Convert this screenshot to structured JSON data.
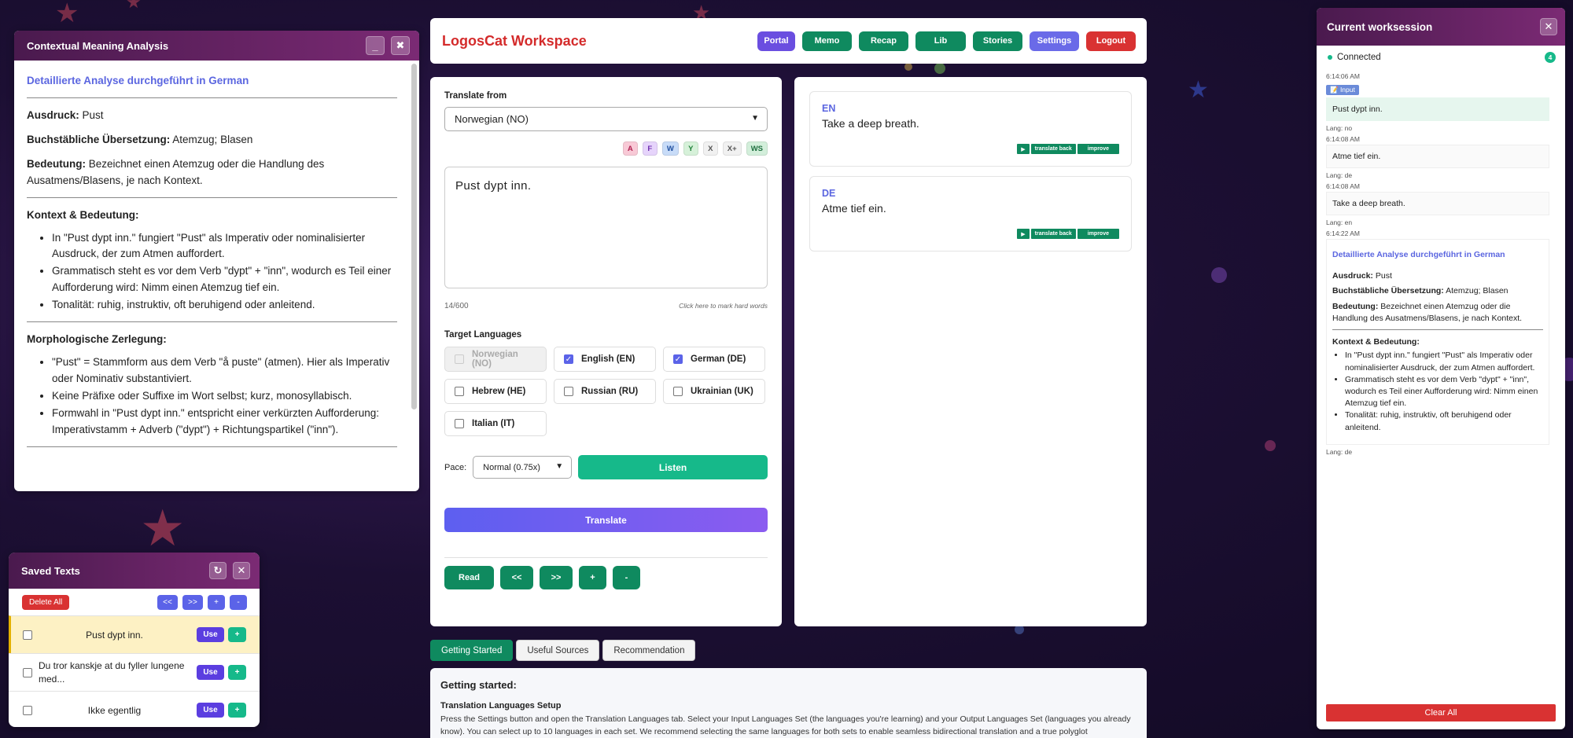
{
  "header": {
    "brand": "LogosCat Workspace",
    "nav": [
      {
        "label": "Portal",
        "color": "#6a4ee0"
      },
      {
        "label": "Memo",
        "color": "#0f8a5f"
      },
      {
        "label": "Recap",
        "color": "#0f8a5f"
      },
      {
        "label": "Lib",
        "color": "#0f8a5f"
      },
      {
        "label": "Stories",
        "color": "#0f8a5f"
      },
      {
        "label": "Settings",
        "color": "#6a6ae8"
      },
      {
        "label": "Logout",
        "color": "#d93232"
      }
    ]
  },
  "analysis": {
    "title": "Contextual Meaning Analysis",
    "minimize": "_",
    "close": "✖",
    "heading": "Detaillierte Analyse durchgeführt in German",
    "ausdruck_label": "Ausdruck:",
    "ausdruck": " Pust",
    "literal_label": "Buchstäbliche Übersetzung:",
    "literal": " Atemzug; Blasen",
    "meaning_label": "Bedeutung:",
    "meaning": " Bezeichnet einen Atemzug oder die Handlung des Ausatmens/Blasens, je nach Kontext.",
    "context_title": "Kontext & Bedeutung:",
    "context_items": [
      "In \"Pust dypt inn.\" fungiert \"Pust\" als Imperativ oder nominalisierter Ausdruck, der zum Atmen auffordert.",
      "Grammatisch steht es vor dem Verb \"dypt\" + \"inn\", wodurch es Teil einer Aufforderung wird: Nimm einen Atemzug tief ein.",
      "Tonalität: ruhig, instruktiv, oft beruhigend oder anleitend."
    ],
    "morph_title": "Morphologische Zerlegung:",
    "morph_items": [
      "\"Pust\" = Stammform aus dem Verb \"å puste\" (atmen). Hier als Imperativ oder Nominativ substantiviert.",
      "Keine Präfixe oder Suffixe im Wort selbst; kurz, monosyllabisch.",
      "Formwahl in \"Pust dypt inn.\" entspricht einer verkürzten Aufforderung: Imperativstamm + Adverb (\"dypt\") + Richtungspartikel (\"inn\")."
    ]
  },
  "saved": {
    "title": "Saved Texts",
    "refresh": "↻",
    "close": "✕",
    "delete_all": "Delete All",
    "nav_buttons": [
      "<<",
      ">>",
      "+",
      "-"
    ],
    "use_label": "Use",
    "add_label": "+",
    "items": [
      {
        "text": "Pust dypt inn."
      },
      {
        "text": "Du tror kanskje at du fyller lungene med..."
      },
      {
        "text": "Ikke egentlig"
      }
    ]
  },
  "translate": {
    "from_label": "Translate from",
    "from_value": "Norwegian (NO)",
    "chips": [
      {
        "label": "A",
        "bg": "#f8c9d6"
      },
      {
        "label": "F",
        "bg": "#e6d4fb"
      },
      {
        "label": "W",
        "bg": "#c8dcf8"
      },
      {
        "label": "Y",
        "bg": "#d6f1d9"
      },
      {
        "label": "X",
        "bg": "#f1f1f1"
      },
      {
        "label": "X+",
        "bg": "#f1f1f1"
      },
      {
        "label": "WS",
        "bg": "#d3efdb"
      }
    ],
    "input_text": "Pust  dypt  inn.",
    "char_count": "14/600",
    "hard_words_hint": "Click here to mark hard words",
    "target_label": "Target Languages",
    "languages": [
      {
        "label": "Norwegian (NO)",
        "checked": false,
        "disabled": true
      },
      {
        "label": "English (EN)",
        "checked": true,
        "disabled": false
      },
      {
        "label": "German (DE)",
        "checked": true,
        "disabled": false
      },
      {
        "label": "Hebrew (HE)",
        "checked": false,
        "disabled": false
      },
      {
        "label": "Russian (RU)",
        "checked": false,
        "disabled": false
      },
      {
        "label": "Ukrainian (UK)",
        "checked": false,
        "disabled": false
      },
      {
        "label": "Italian (IT)",
        "checked": false,
        "disabled": false
      }
    ],
    "pace_label": "Pace:",
    "pace_value": "Normal (0.75x)",
    "listen_label": "Listen",
    "translate_label": "Translate",
    "read_buttons": [
      "Read",
      "<<",
      ">>",
      "+",
      "-"
    ]
  },
  "results": {
    "play_icon": "▶",
    "back_label": "translate back",
    "improve_label": "improve",
    "items": [
      {
        "code": "EN",
        "text": "Take a deep breath."
      },
      {
        "code": "DE",
        "text": "Atme tief ein."
      }
    ]
  },
  "tabs": [
    {
      "label": "Getting Started",
      "active": true
    },
    {
      "label": "Useful Sources",
      "active": false
    },
    {
      "label": "Recommendation",
      "active": false
    }
  ],
  "getting_started": {
    "title": "Getting started:",
    "subtitle": "Translation Languages Setup",
    "body": "Press the Settings button and open the Translation Languages tab. Select your Input Languages Set (the languages you're learning) and your Output Languages Set (languages you already know). You can select up to 10 languages in each set. We recommend selecting the same languages for both sets to enable seamless bidirectional translation and a true polyglot"
  },
  "worksession": {
    "title": "Current worksession",
    "close": "✕",
    "status": "Connected",
    "count": "4",
    "entries": [
      {
        "time": "6:14:06 AM",
        "tag": "📝 Input",
        "text": "Pust dypt inn.",
        "lang": "Lang: no",
        "input": true
      },
      {
        "time": "6:14:08 AM",
        "tag": "",
        "text": "Atme tief ein.",
        "lang": "Lang: de",
        "input": false
      },
      {
        "time": "6:14:08 AM",
        "tag": "",
        "text": "Take a deep breath.",
        "lang": "Lang: en",
        "input": false
      }
    ],
    "analysis_time": "6:14:22 AM",
    "analysis_lang": "Lang: de",
    "clear_all": "Clear All"
  }
}
